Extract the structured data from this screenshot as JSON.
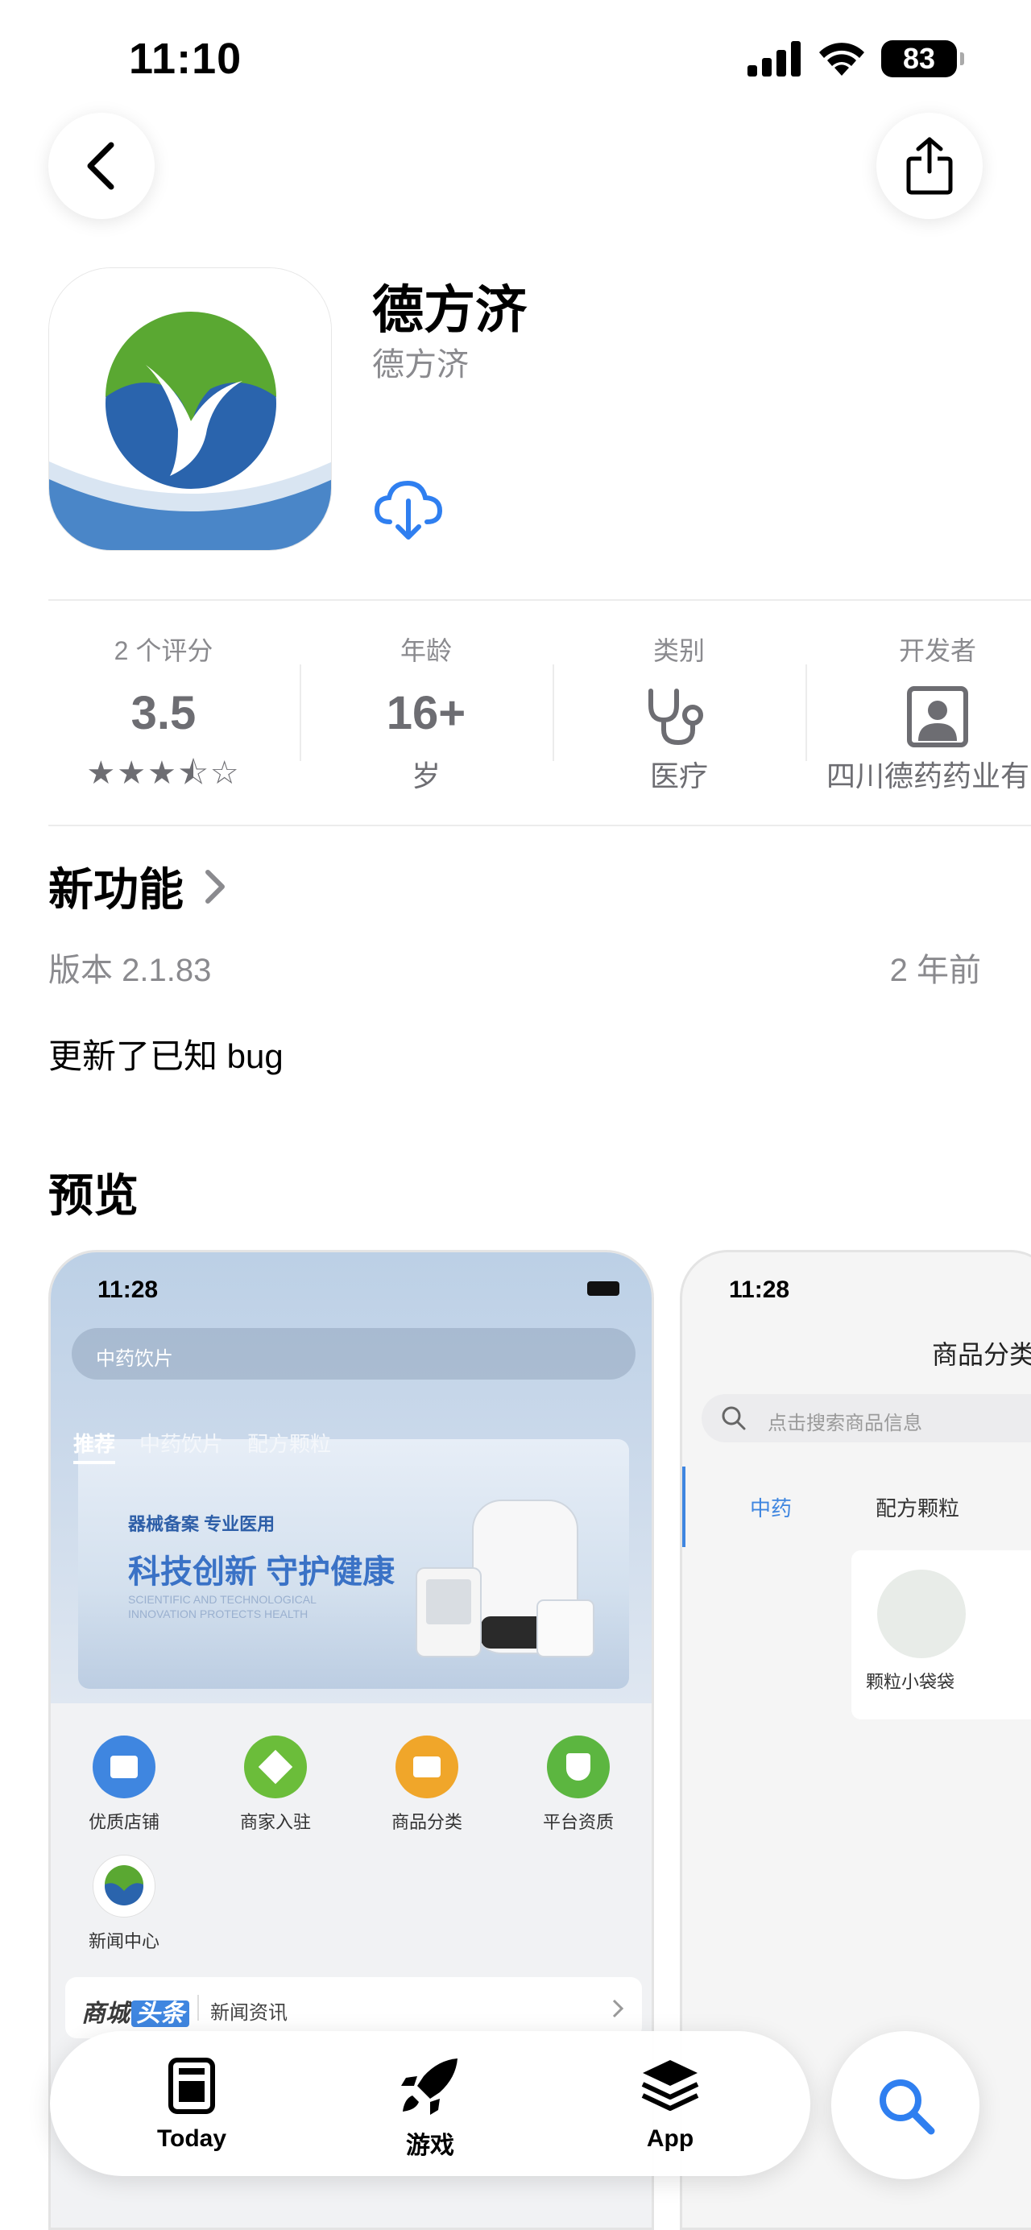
{
  "status_bar": {
    "time": "11:10",
    "battery": "83"
  },
  "app": {
    "name": "德方济",
    "developer": "德方济"
  },
  "info": {
    "ratings": {
      "label": "2 个评分",
      "value": "3.5",
      "stars": "★★★⯪☆"
    },
    "age": {
      "label": "年龄",
      "value": "16+",
      "unit": "岁"
    },
    "category": {
      "label": "类别",
      "value": "医疗"
    },
    "developer": {
      "label": "开发者",
      "value": "四川德药药业有"
    }
  },
  "whats_new": {
    "title": "新功能",
    "version": "版本 2.1.83",
    "date": "2 年前",
    "notes": "更新了已知 bug"
  },
  "preview": {
    "title": "预览",
    "shot1": {
      "time": "11:28",
      "search": "中药饮片",
      "tabs": [
        "推荐",
        "中药饮片",
        "配方颗粒"
      ],
      "banner_small": "器械备案 专业医用",
      "banner_big": "科技创新 守护健康",
      "banner_en": "SCIENTIFIC AND TECHNOLOGICAL INNOVATION PROTECTS HEALTH",
      "grid": [
        "优质店铺",
        "商家入驻",
        "商品分类",
        "平台资质",
        "新闻中心"
      ],
      "news_brand_a": "商城",
      "news_brand_b": "头条",
      "news_text": "新闻资讯"
    },
    "shot2": {
      "time": "11:28",
      "title": "商品分类",
      "search": "点击搜索商品信息",
      "tabs": [
        "中药",
        "配方颗粒"
      ],
      "card": "颗粒小袋袋"
    }
  },
  "tab_bar": {
    "items": [
      "Today",
      "游戏",
      "App"
    ]
  },
  "colors": {
    "accent": "#2f7ff0",
    "icon_green": "#5aa832",
    "icon_blue": "#2a64ad"
  }
}
